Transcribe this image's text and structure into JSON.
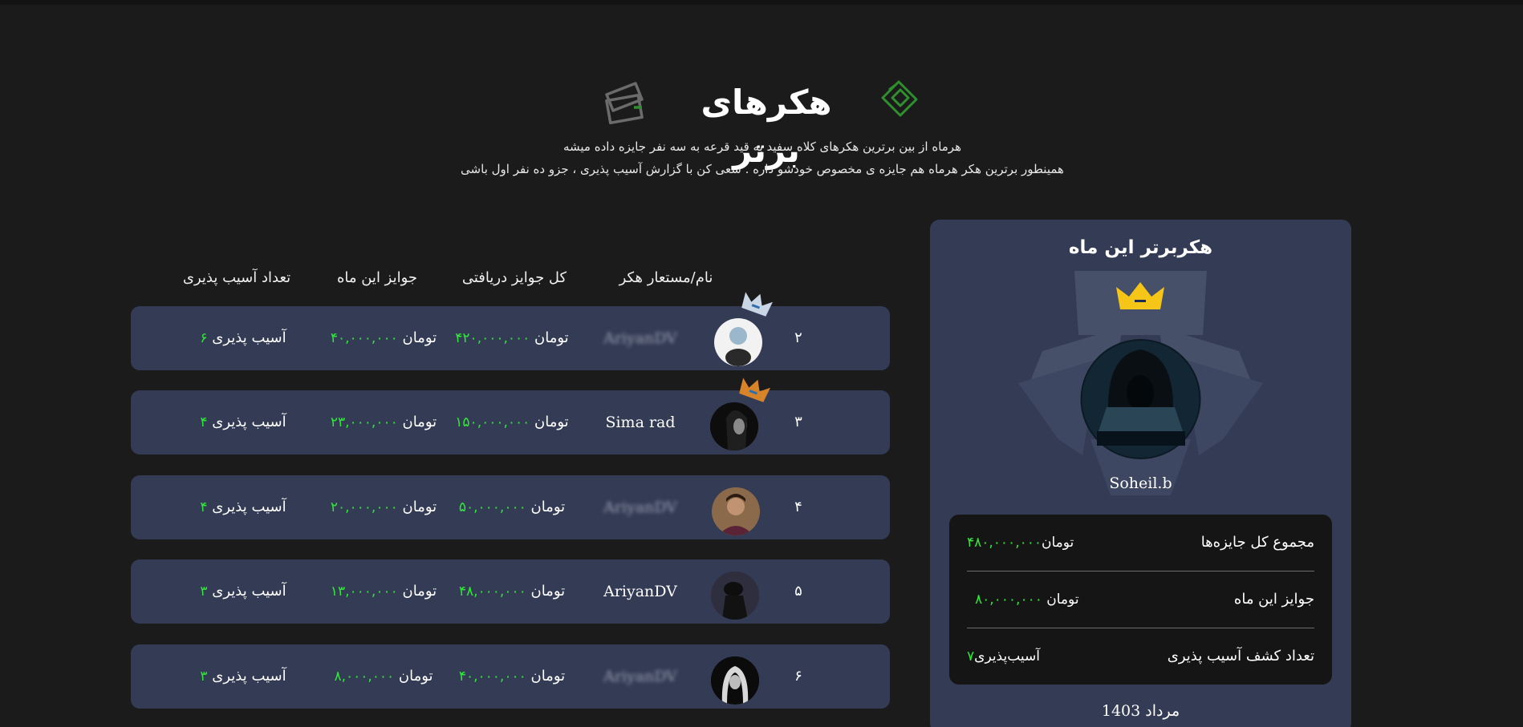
{
  "header": {
    "title": "هکرهای برتر",
    "desc_line1": "هرماه از بین برترین هکرهای کلاه سفید به قید قرعه به سه نفر جایزه داده میشه",
    "desc_line2": "همینطور برترین هکر هرماه هم جایزه ی مخصوص خودشو داره . سعی کن با گزارش آسیب پذیری ، جزو ده نفر اول باشی",
    "icons": [
      "wallet-icon",
      "money-bag-icon"
    ]
  },
  "table": {
    "headers": {
      "name": "نام/مستعار هکر",
      "total": "کل جوایز دریافتی",
      "month": "جوایز این ماه",
      "vulns": "تعداد آسیب پذیری"
    },
    "currency": "تومان",
    "rows": [
      {
        "rank": "۲",
        "name": "AriyanDV",
        "total": "۴۲۰,۰۰۰,۰۰۰",
        "month": "۴۰,۰۰۰,۰۰۰",
        "vuln_label": "آسیب پذیری",
        "vuln_count": "۶"
      },
      {
        "rank": "۳",
        "name": "Sima rad",
        "total": "۱۵۰,۰۰۰,۰۰۰",
        "month": "۲۳,۰۰۰,۰۰۰",
        "vuln_label": "آسیب پذیری",
        "vuln_count": "۴"
      },
      {
        "rank": "۴",
        "name": "AriyanDV",
        "total": "۵۰,۰۰۰,۰۰۰",
        "month": "۲۰,۰۰۰,۰۰۰",
        "vuln_label": "آسیب پذیری",
        "vuln_count": "۴"
      },
      {
        "rank": "۵",
        "name": "AriyanDV",
        "total": "۴۸,۰۰۰,۰۰۰",
        "month": "۱۳,۰۰۰,۰۰۰",
        "vuln_label": "آسیب پذیری",
        "vuln_count": "۳"
      },
      {
        "rank": "۶",
        "name": "AriyanDV",
        "total": "۴۰,۰۰۰,۰۰۰",
        "month": "۸,۰۰۰,۰۰۰",
        "vuln_label": "آسیب پذیری",
        "vuln_count": "۳"
      }
    ]
  },
  "top_hacker": {
    "title": "هکربرتر این ماه",
    "name": "Soheil.b",
    "stats": [
      {
        "label": "مجموع کل جایزه‌ها",
        "currency": "تومان",
        "value": "۴۸۰,۰۰۰,۰۰۰"
      },
      {
        "label": "جوایز این ماه",
        "currency": "تومان",
        "value": "۸۰,۰۰۰,۰۰۰"
      },
      {
        "label": "تعداد کشف آسیب پذیری",
        "currency": "آسیب‌پذیری",
        "value": "۷"
      }
    ],
    "date": "مرداد 1403"
  },
  "colors": {
    "background": "#1b1b1b",
    "card": "#333b55",
    "accent_green": "#31e73a",
    "crown_gold": "#f5c518",
    "crown_silver": "#c9d6e6",
    "crown_bronze": "#d7832a"
  }
}
